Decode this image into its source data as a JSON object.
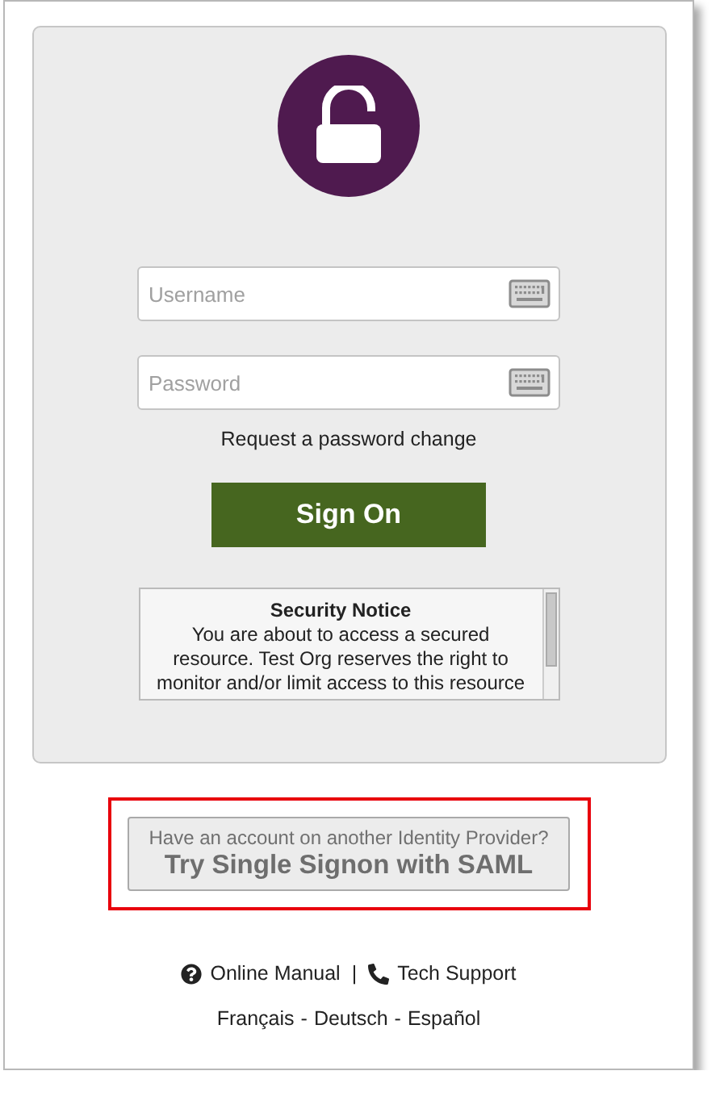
{
  "login": {
    "username": {
      "placeholder": "Username"
    },
    "password": {
      "placeholder": "Password"
    },
    "password_link": "Request a password change",
    "sign_on_button": "Sign On",
    "security_notice": {
      "title": "Security Notice",
      "lines": [
        "You are about to access a secured",
        "resource. Test Org reserves the right to",
        "monitor and/or limit access to this resource"
      ]
    }
  },
  "saml": {
    "prompt": "Have an account on another Identity Provider?",
    "button": "Try Single Signon with SAML"
  },
  "footer": {
    "links": [
      {
        "kind": "help",
        "label": "Online Manual"
      },
      {
        "kind": "phone",
        "label": "Tech Support"
      }
    ],
    "link_separator": "|",
    "languages": [
      "Français",
      "Deutsch",
      "Español"
    ],
    "language_separator": "-"
  }
}
